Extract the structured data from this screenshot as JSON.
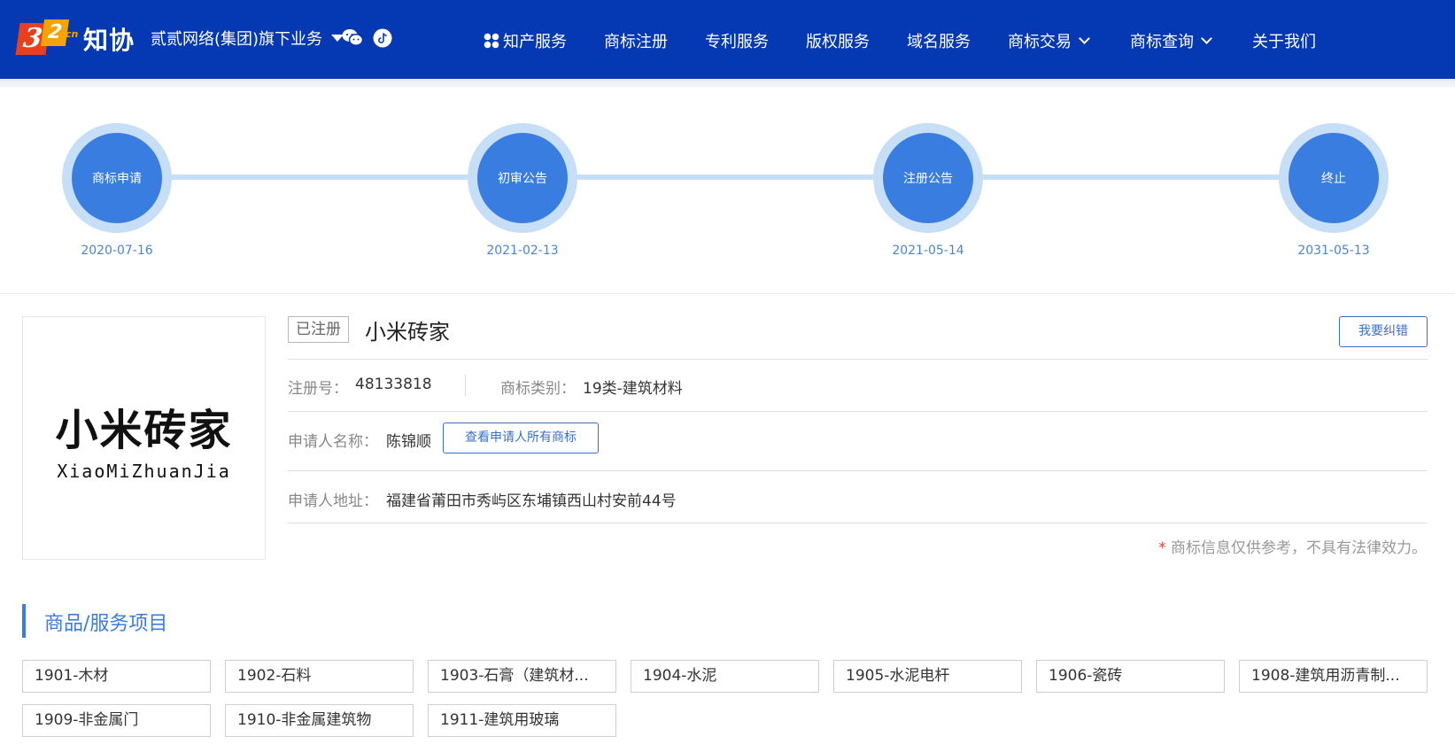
{
  "header": {
    "logo_mark": "32",
    "logo_suffix": "cn",
    "logo_text": "知协",
    "group_label": "贰贰网络(集团)旗下业务",
    "social_icons": [
      "wechat-icon",
      "douyin-icon"
    ],
    "nav": [
      {
        "label": "知产服务",
        "icon": "grid-icon"
      },
      {
        "label": "商标注册"
      },
      {
        "label": "专利服务"
      },
      {
        "label": "版权服务"
      },
      {
        "label": "域名服务"
      },
      {
        "label": "商标交易",
        "dropdown": true
      },
      {
        "label": "商标查询",
        "dropdown": true
      },
      {
        "label": "关于我们"
      }
    ]
  },
  "timeline": [
    {
      "label": "商标申请",
      "date": "2020-07-16"
    },
    {
      "label": "初审公告",
      "date": "2021-02-13"
    },
    {
      "label": "注册公告",
      "date": "2021-05-14"
    },
    {
      "label": "终止",
      "date": "2031-05-13"
    }
  ],
  "trademark": {
    "image_text": "小米砖家",
    "image_pinyin": "XiaoMiZhuanJia",
    "status": "已注册",
    "name": "小米砖家",
    "correct_label": "我要纠错",
    "reg_no_label": "注册号：",
    "reg_no": "48133818",
    "class_label": "商标类别：",
    "class_value": "19类-建筑材料",
    "applicant_label": "申请人名称：",
    "applicant": "陈锦顺",
    "view_all_label": "查看申请人所有商标",
    "address_label": "申请人地址：",
    "address": "福建省莆田市秀屿区东埔镇西山村安前44号",
    "disclaimer_star": "*",
    "disclaimer": "商标信息仅供参考，不具有法律效力。"
  },
  "goods_section": {
    "title": "商品/服务项目",
    "items": [
      "1901-木材",
      "1902-石料",
      "1903-石膏（建筑材...",
      "1904-水泥",
      "1905-水泥电杆",
      "1906-瓷砖",
      "1908-建筑用沥青制...",
      "1909-非金属门",
      "1910-非金属建筑物",
      "1911-建筑用玻璃"
    ]
  },
  "colors": {
    "header_bg": "#0538b3",
    "accent": "#3a7de0",
    "timeline_ring": "#c6def6"
  }
}
